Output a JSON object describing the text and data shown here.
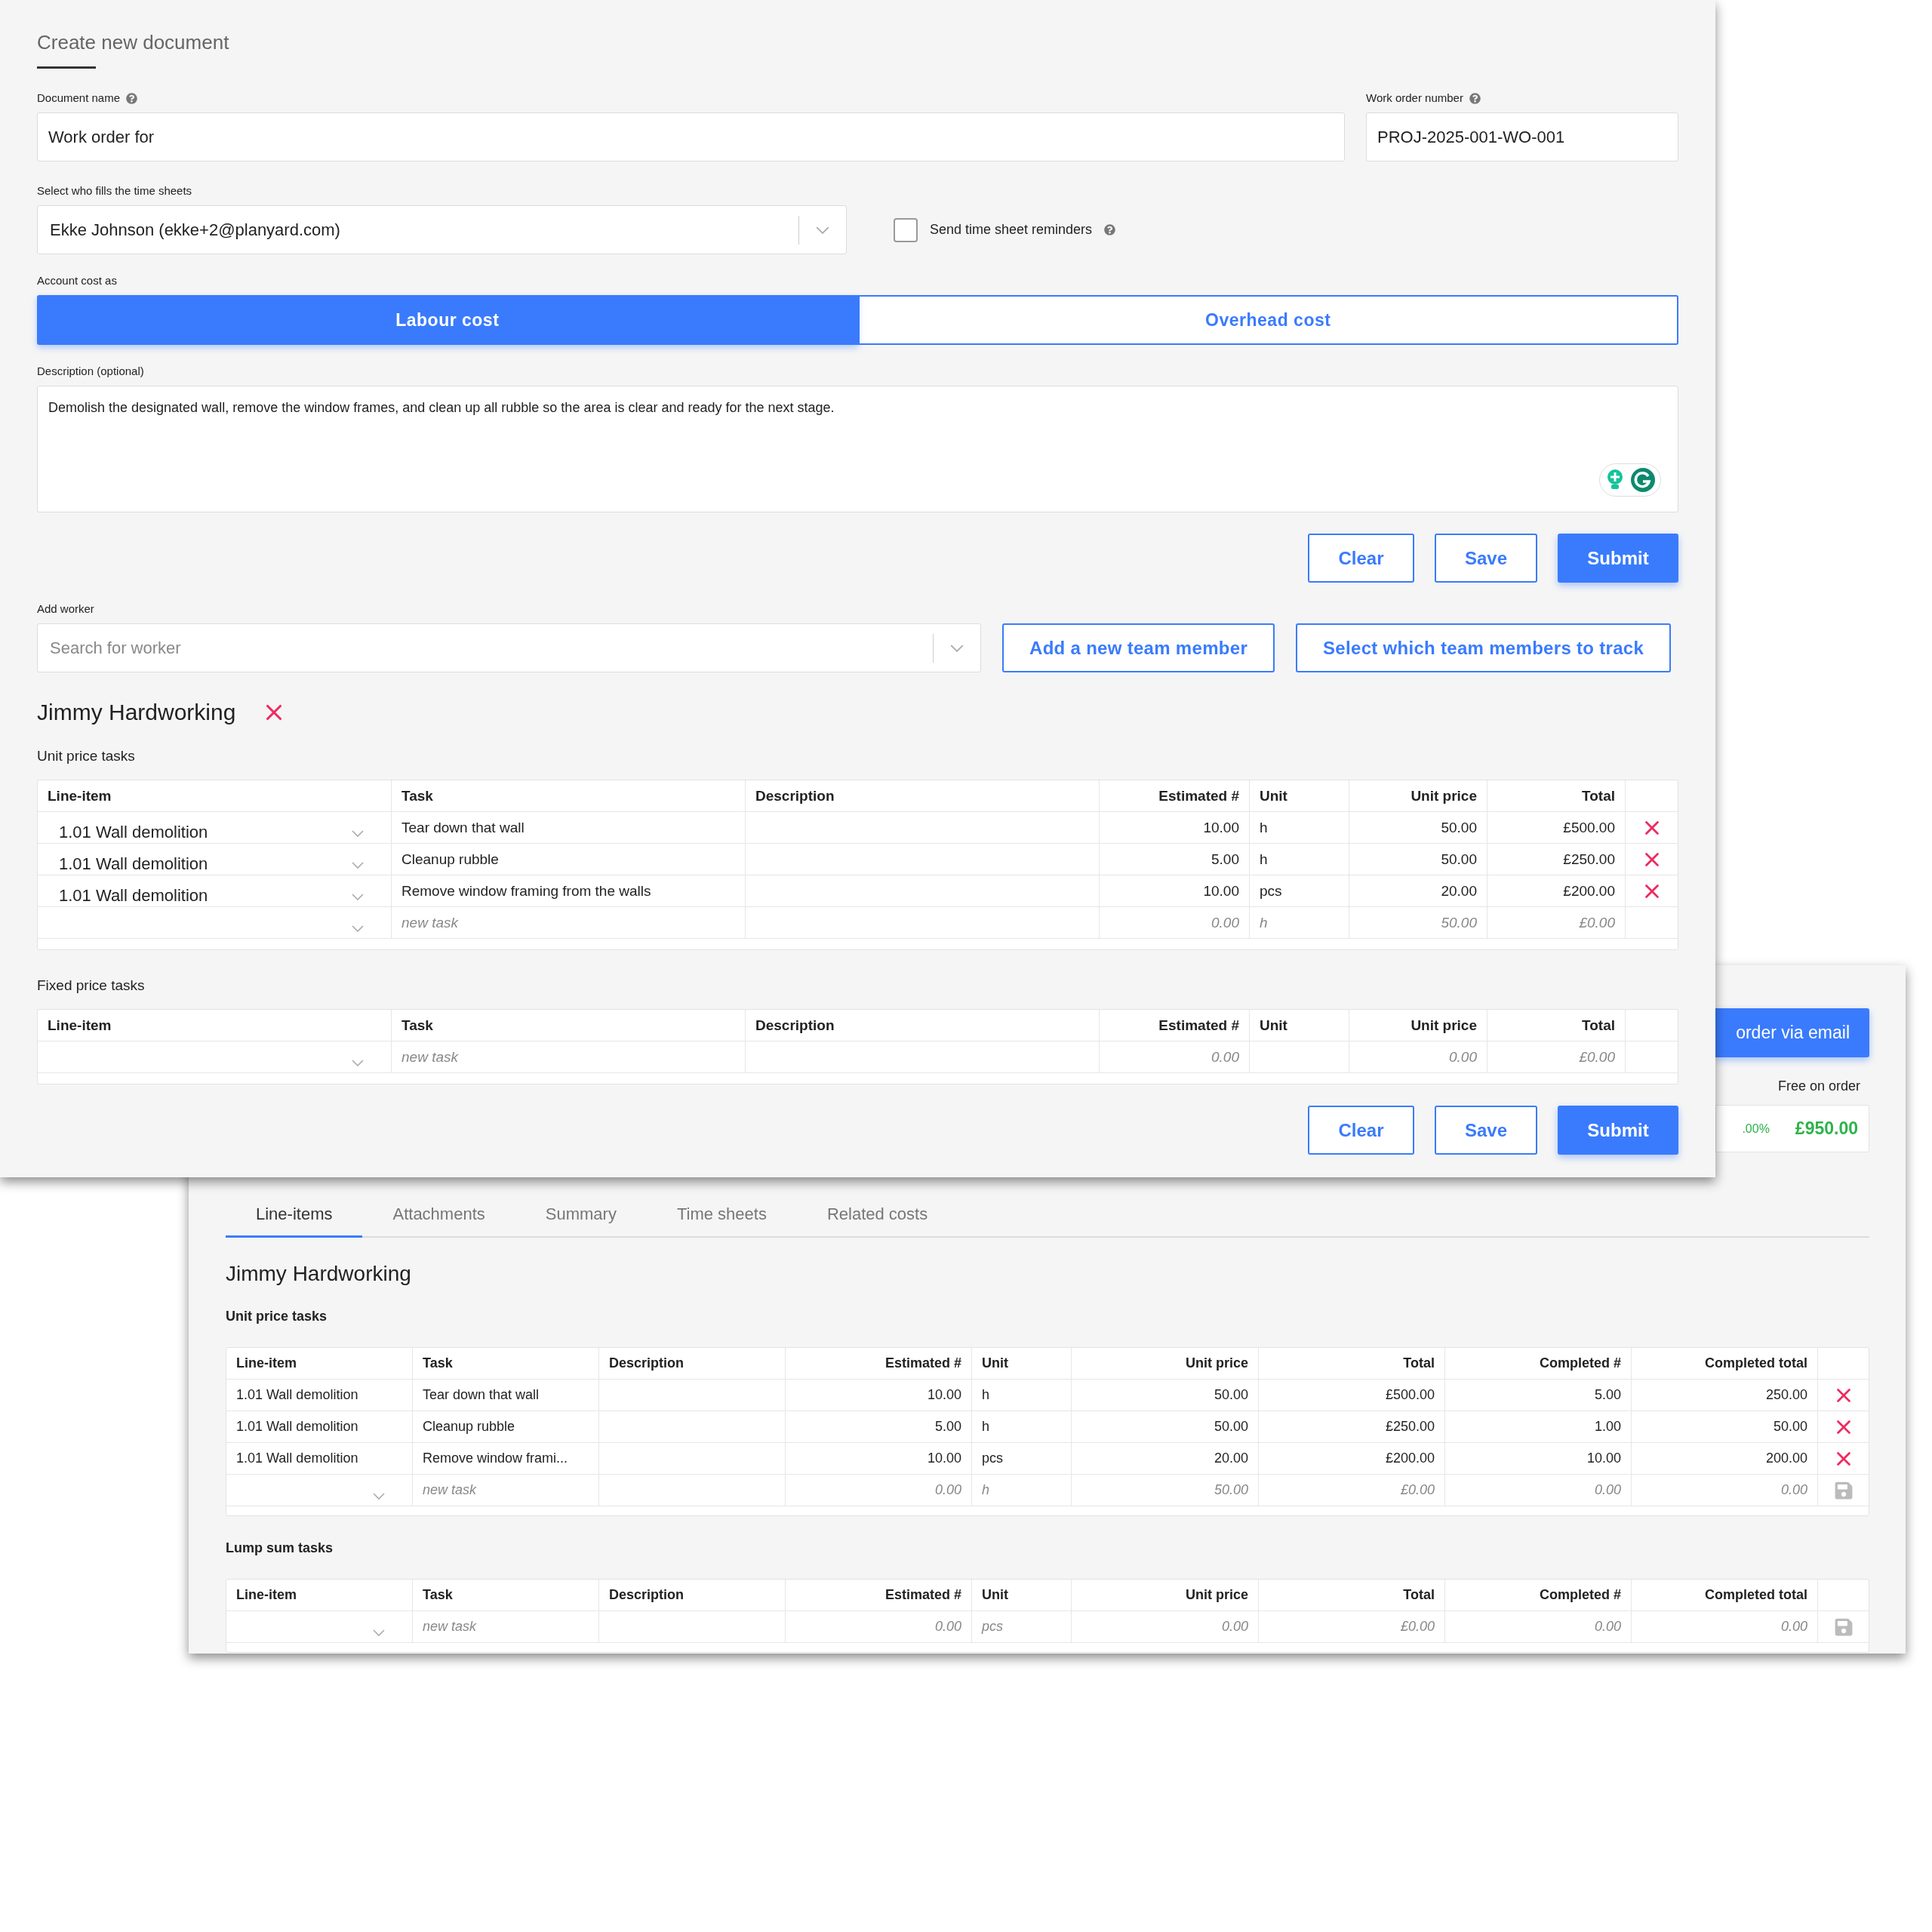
{
  "front": {
    "title": "Create new document",
    "document_name": {
      "label": "Document name",
      "value": "Work order for"
    },
    "work_order_number": {
      "label": "Work order number",
      "value": "PROJ-2025-001-WO-001"
    },
    "time_sheets": {
      "label": "Select who fills the time sheets",
      "value": "Ekke Johnson (ekke+2@planyard.com)"
    },
    "reminders": {
      "label": "Send time sheet reminders",
      "checked": false
    },
    "account_cost": {
      "label": "Account cost as",
      "options": [
        {
          "label": "Labour cost",
          "selected": true
        },
        {
          "label": "Overhead cost",
          "selected": false
        }
      ]
    },
    "description": {
      "label": "Description (optional)",
      "value": "Demolish the designated wall, remove the window frames, and clean up all rubble so the area is clear and ready for the next stage."
    },
    "actions": [
      {
        "label": "Clear",
        "kind": "outline"
      },
      {
        "label": "Save",
        "kind": "outline"
      },
      {
        "label": "Submit",
        "kind": "primary"
      }
    ],
    "add_worker": {
      "label": "Add worker",
      "placeholder": "Search for worker"
    },
    "worker_buttons": [
      "Add a new team member",
      "Select which team members to track"
    ],
    "worker": {
      "name": "Jimmy Hardworking"
    },
    "tables": [
      {
        "title": "Unit price tasks",
        "columns": [
          "Line-item",
          "Task",
          "Description",
          "Estimated #",
          "Unit",
          "Unit price",
          "Total"
        ],
        "rows": [
          {
            "kind": "task",
            "cells": [
              "1.01 Wall demolition",
              "Tear down that wall",
              null,
              "10.00",
              "h",
              "50.00",
              "£500.00"
            ]
          },
          {
            "kind": "task",
            "cells": [
              "1.01 Wall demolition",
              "Cleanup rubble",
              null,
              "5.00",
              "h",
              "50.00",
              "£250.00"
            ]
          },
          {
            "kind": "task",
            "cells": [
              "1.01 Wall demolition",
              "Remove window framing from the walls",
              null,
              "10.00",
              "pcs",
              "20.00",
              "£200.00"
            ]
          },
          {
            "kind": "new",
            "cells": [
              null,
              "new task",
              null,
              "0.00",
              "h",
              "50.00",
              "£0.00"
            ]
          }
        ]
      },
      {
        "title": "Fixed price tasks",
        "columns": [
          "Line-item",
          "Task",
          "Description",
          "Estimated #",
          "Unit",
          "Unit price",
          "Total"
        ],
        "rows": [
          {
            "kind": "new",
            "cells": [
              null,
              "new task",
              null,
              "0.00",
              null,
              "0.00",
              "£0.00"
            ]
          }
        ]
      }
    ],
    "bottom_actions": [
      {
        "label": "Clear",
        "kind": "outline"
      },
      {
        "label": "Save",
        "kind": "outline"
      },
      {
        "label": "Submit",
        "kind": "primary"
      }
    ]
  },
  "back": {
    "email_button": "order via email",
    "free_on_order": "Free on order",
    "percent": ".00%",
    "amount": "£950.00",
    "tabs": [
      {
        "label": "Line-items",
        "selected": true
      },
      {
        "label": "Attachments",
        "selected": false
      },
      {
        "label": "Summary",
        "selected": false
      },
      {
        "label": "Time sheets",
        "selected": false
      },
      {
        "label": "Related costs",
        "selected": false
      }
    ],
    "worker": {
      "name": "Jimmy Hardworking"
    },
    "tables": [
      {
        "title": "Unit price tasks",
        "columns": [
          "Line-item",
          "Task",
          "Description",
          "Estimated #",
          "Unit",
          "Unit price",
          "Total",
          "Completed #",
          "Completed total"
        ],
        "rows": [
          {
            "kind": "task",
            "cells": [
              "1.01 Wall demolition",
              "Tear down that wall",
              null,
              "10.00",
              "h",
              "50.00",
              "£500.00",
              "5.00",
              "250.00"
            ]
          },
          {
            "kind": "task",
            "cells": [
              "1.01 Wall demolition",
              "Cleanup rubble",
              null,
              "5.00",
              "h",
              "50.00",
              "£250.00",
              "1.00",
              "50.00"
            ]
          },
          {
            "kind": "task",
            "cells": [
              "1.01 Wall demolition",
              "Remove window frami...",
              null,
              "10.00",
              "pcs",
              "20.00",
              "£200.00",
              "10.00",
              "200.00"
            ]
          },
          {
            "kind": "new",
            "cells": [
              null,
              "new task",
              null,
              "0.00",
              "h",
              "50.00",
              "£0.00",
              "0.00",
              "0.00"
            ]
          }
        ]
      },
      {
        "title": "Lump sum tasks",
        "columns": [
          "Line-item",
          "Task",
          "Description",
          "Estimated #",
          "Unit",
          "Unit price",
          "Total",
          "Completed #",
          "Completed total"
        ],
        "rows": [
          {
            "kind": "new",
            "cells": [
              null,
              "new task",
              null,
              "0.00",
              "pcs",
              "0.00",
              "£0.00",
              "0.00",
              "0.00"
            ]
          }
        ]
      }
    ]
  }
}
